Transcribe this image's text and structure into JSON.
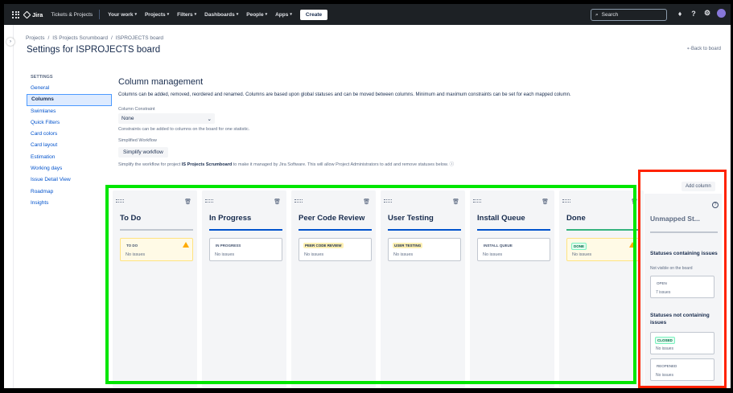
{
  "topnav": {
    "product": "Jira",
    "items": [
      {
        "label": "Tickets & Projects",
        "chevron": false
      },
      {
        "label": "Your work",
        "chevron": true
      },
      {
        "label": "Projects",
        "chevron": true
      },
      {
        "label": "Filters",
        "chevron": true
      },
      {
        "label": "Dashboards",
        "chevron": true
      },
      {
        "label": "People",
        "chevron": true
      },
      {
        "label": "Apps",
        "chevron": true
      }
    ],
    "create_label": "Create",
    "search_placeholder": "Search"
  },
  "breadcrumb": [
    "Projects",
    "IS Projects Scrumboard",
    "ISPROJECTS board"
  ],
  "page_title": "Settings for ISPROJECTS board",
  "back_link": "Back to board",
  "settings_nav": {
    "heading": "SETTINGS",
    "items": [
      "General",
      "Columns",
      "Swimlanes",
      "Quick Filters",
      "Card colors",
      "Card layout",
      "Estimation",
      "Working days",
      "Issue Detail View",
      "Roadmap",
      "Insights"
    ],
    "active": "Columns"
  },
  "main": {
    "heading": "Column management",
    "description": "Columns can be added, removed, reordered and renamed. Columns are based upon global statuses and can be moved between columns. Minimum and maximum constraints can be set for each mapped column.",
    "constraint_label": "Column Constraint",
    "constraint_value": "None",
    "constraint_hint": "Constraints can be added to columns on the board for one statistic.",
    "workflow_label": "Simplified Workflow",
    "simplify_button": "Simplify workflow",
    "simplify_text_pre": "Simplify the workflow for project ",
    "simplify_text_project": "IS Projects Scrumboard",
    "simplify_text_post": " to make it managed by Jira Software. This will allow Project Administrators to add and remove statuses below."
  },
  "columns": [
    {
      "name": "To Do",
      "status": "TO DO",
      "issues": "No issues",
      "underline": "gray",
      "warning": true,
      "lozenge": "plain"
    },
    {
      "name": "In Progress",
      "status": "IN PROGRESS",
      "issues": "No issues",
      "underline": "blue",
      "warning": false,
      "lozenge": "plain"
    },
    {
      "name": "Peer Code Review",
      "status": "PEER CODE REVIEW",
      "issues": "No issues",
      "underline": "blue",
      "warning": false,
      "lozenge": "yellow"
    },
    {
      "name": "User Testing",
      "status": "USER TESTING",
      "issues": "No issues",
      "underline": "blue",
      "warning": false,
      "lozenge": "yellow"
    },
    {
      "name": "Install Queue",
      "status": "INSTALL QUEUE",
      "issues": "No issues",
      "underline": "blue",
      "warning": false,
      "lozenge": "plain"
    },
    {
      "name": "Done",
      "status": "DONE",
      "issues": "No issues",
      "underline": "green",
      "warning": true,
      "lozenge": "green"
    }
  ],
  "add_column": "Add column",
  "unmapped": {
    "title": "Unmapped St...",
    "with_issues_title": "Statuses containing issues",
    "with_issues_sub": "Not visible on the board",
    "with_issues": [
      {
        "status": "OPEN",
        "issues": "7 issues"
      }
    ],
    "without_issues_title": "Statuses not containing issues",
    "without_issues": [
      {
        "status": "CLOSED",
        "issues": "No issues",
        "green": true
      },
      {
        "status": "REOPENED",
        "issues": "No issues",
        "green": false
      }
    ]
  },
  "colors": {
    "accent": "#0052cc",
    "highlight_green": "#00e600",
    "highlight_red": "#ff2200",
    "nav_bg": "#1d2125"
  }
}
